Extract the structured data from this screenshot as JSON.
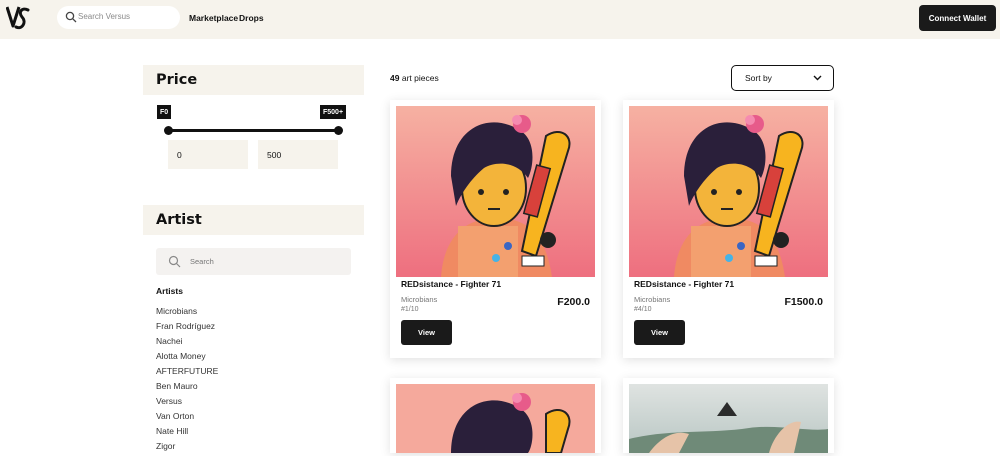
{
  "header": {
    "search_placeholder": "Search Versus",
    "nav": [
      "Marketplace",
      "Drops"
    ],
    "connect_label": "Connect Wallet"
  },
  "filters": {
    "price": {
      "title": "Price",
      "min_tag": "F0",
      "max_tag": "F500+",
      "min_value": "0",
      "max_value": "500"
    },
    "artist": {
      "title": "Artist",
      "search_placeholder": "Search",
      "list_title": "Artists",
      "artists": [
        "Microbians",
        "Fran Rodríguez",
        "Nachei",
        "Alotta Money",
        "AFTERFUTURE",
        "Ben Mauro",
        "Versus",
        "Van Orton",
        "Nate Hill",
        "Zigor"
      ]
    }
  },
  "results": {
    "count": "49",
    "count_suffix": "art pieces",
    "sort_label": "Sort by"
  },
  "cards": [
    {
      "title": "REDsistance - Fighter 71",
      "artist": "Microbians",
      "edition": "#1/10",
      "price": "F200.0",
      "view": "View"
    },
    {
      "title": "REDsistance - Fighter 71",
      "artist": "Microbians",
      "edition": "#4/10",
      "price": "F1500.0",
      "view": "View"
    }
  ],
  "colors": {
    "accent": "#1a1a1a",
    "panel": "#f6f3ec",
    "art_background": "#f4a89a"
  }
}
